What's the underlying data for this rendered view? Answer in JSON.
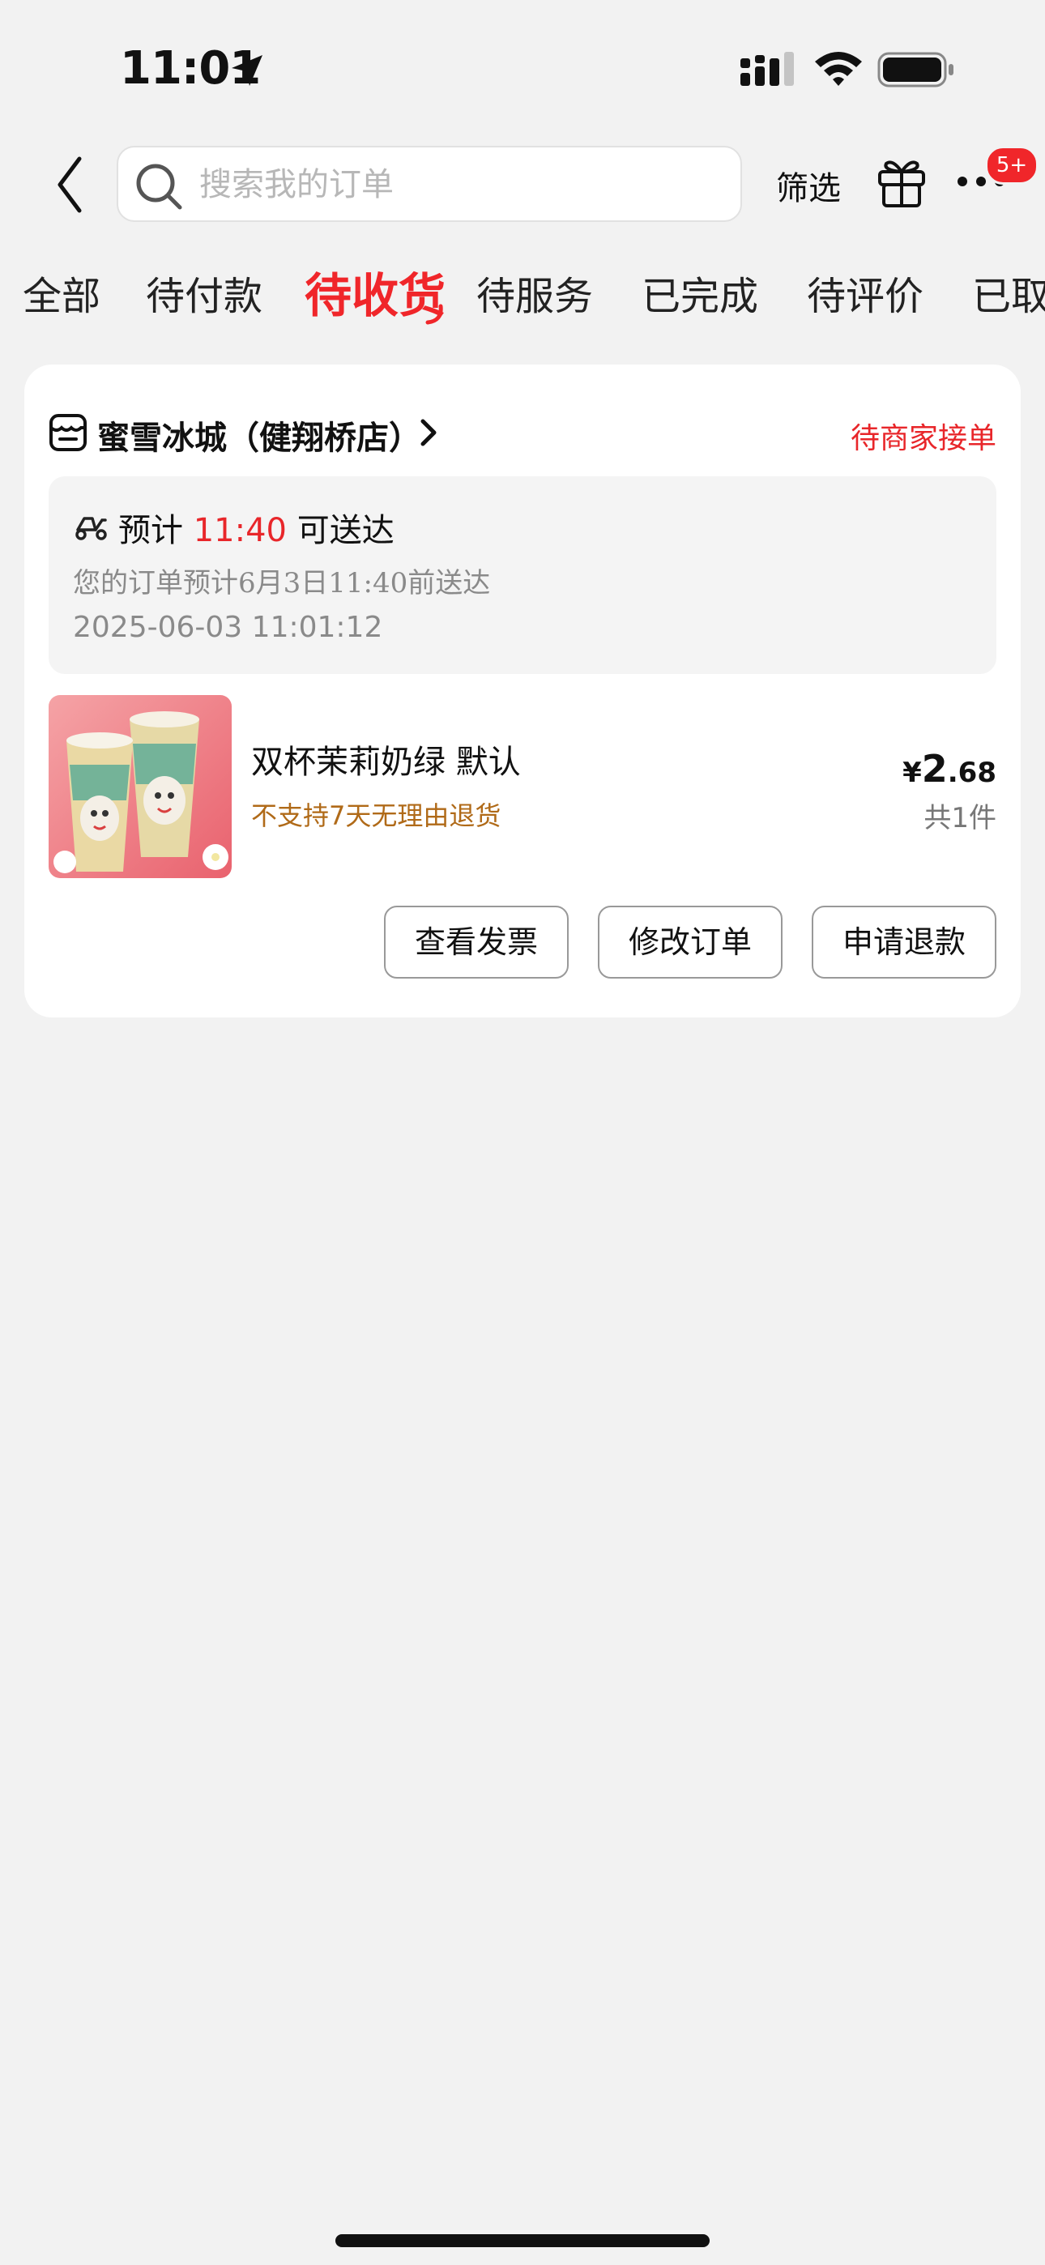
{
  "status_bar": {
    "time": "11:01"
  },
  "header": {
    "search_placeholder": "搜索我的订单",
    "filter_label": "筛选",
    "more_badge": "5+"
  },
  "tabs": [
    {
      "label": "全部"
    },
    {
      "label": "待付款"
    },
    {
      "label": "待收货",
      "active": true
    },
    {
      "label": "待服务"
    },
    {
      "label": "已完成"
    },
    {
      "label": "待评价"
    },
    {
      "label": "已取消"
    }
  ],
  "order": {
    "shop_name": "蜜雪冰城（健翔桥店）",
    "status": "待商家接单",
    "delivery": {
      "eta_prefix": "预计",
      "eta_time": "11:40",
      "eta_suffix": "可送达",
      "description": "您的订单预计6月3日11:40前送达",
      "timestamp": "2025-06-03 11:01:12"
    },
    "item": {
      "name": "双杯茉莉奶绿 默认",
      "note": "不支持7天无理由退货",
      "price_symbol": "¥",
      "price_integer": "2",
      "price_decimal": ".68",
      "quantity": "共1件"
    },
    "actions": {
      "invoice": "查看发票",
      "modify": "修改订单",
      "refund": "申请退款"
    }
  },
  "colors": {
    "accent": "#f0262a",
    "note": "#b06a18",
    "background": "#f2f2f2"
  }
}
